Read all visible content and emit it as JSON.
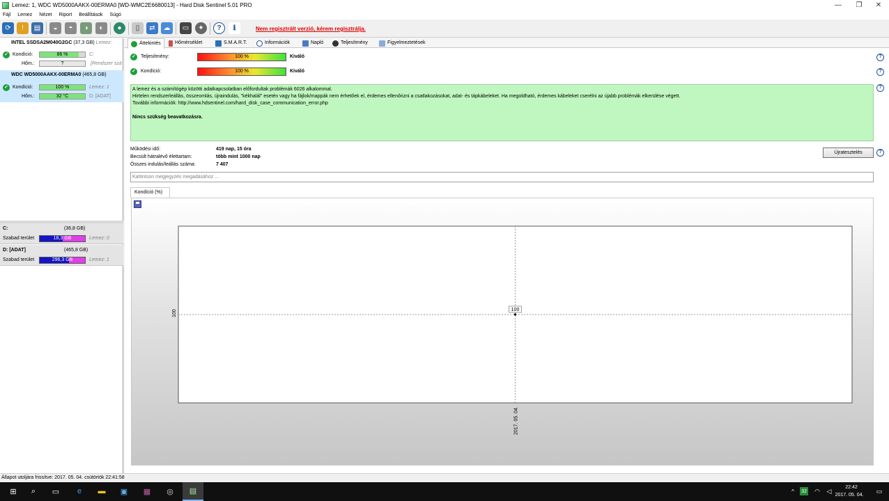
{
  "window": {
    "title": "Lemez: 1, WDC WD5000AAKX-00ERMA0 [WD-WMC2E6680013]  -  Hard Disk Sentinel 5.01 PRO",
    "controls": {
      "minimize": "—",
      "restore": "❐",
      "close": "✕"
    }
  },
  "menu": [
    "Fájl",
    "Lemez",
    "Nézet",
    "Riport",
    "Beállítások",
    "Súgó"
  ],
  "toolbar": {
    "registration_link": "Nem regisztrált verzió, kérem regisztrálja."
  },
  "disks": [
    {
      "name": "INTEL SSDSA2M040G2GC",
      "size": "(37,3 GB)",
      "disk_label": "Lemez:",
      "condition_label": "Kondíció:",
      "condition_value": "86 %",
      "condition_fraction": 0.86,
      "condition_extra": "C:",
      "temp_label": "Hőm.:",
      "temp_value": "?",
      "temp_extra": "[Rendszer szá"
    },
    {
      "name": "WDC WD5000AAKX-00ERMA0",
      "size": "(465,8 GB)",
      "condition_label": "Kondíció:",
      "condition_value": "100 %",
      "condition_fraction": 1.0,
      "condition_extra": "Lemez: 1",
      "temp_label": "Hőm.:",
      "temp_value": "32 °C",
      "temp_extra": "D: [ADAT]"
    }
  ],
  "volumes": [
    {
      "name": "C:",
      "size": "(36,8 GB)",
      "free_label": "Szabad terület",
      "free_value": "18,3 GB",
      "free_fraction": 0.5,
      "disk": "Lemez: 0"
    },
    {
      "name": "D: [ADAT]",
      "size": "(465,8 GB)",
      "free_label": "Szabad terület",
      "free_value": "296,3 GB",
      "free_fraction": 0.64,
      "disk": "Lemez: 1"
    }
  ],
  "tabs": [
    "Áttekintés",
    "Hőmérséklet",
    "S.M.A.R.T.",
    "Információk",
    "Napló",
    "Teljesítmény",
    "Figyelmeztetések"
  ],
  "overview": {
    "performance": {
      "label": "Teljesítmény:",
      "value": "100 %",
      "fraction": 1.0,
      "verdict": "Kiváló"
    },
    "condition": {
      "label": "Kondíció:",
      "value": "100 %",
      "fraction": 1.0,
      "verdict": "Kiváló"
    },
    "message_lines": [
      "A lemez és a számítógép közötti adatkapcsolatban előfordultak problémák 6026 alkalommal.",
      "Hirtelen rendszerleállás, összeomlás, újraindulás, \"kékhalál\" esetén vagy ha fájlok/mappák nem érhetőek el, érdemes ellenőrizni a csatlakozásokat, adat- és tápkábeleket. Ha megoldható, érdemes kábeleket cserélni az újabb problémák elkerülése végett.",
      "További információk: http://www.hdsentinel.com/hard_disk_case_communication_error.php"
    ],
    "message_action": "Nincs szükség beavatkozásra.",
    "stats": [
      {
        "label": "Működési idő:",
        "value": "419 nap, 15 óra"
      },
      {
        "label": "Becsült hátralévő élettartam:",
        "value": "több mint 1000 nap"
      },
      {
        "label": "Összes indulás/leállás száma:",
        "value": "7 407"
      }
    ],
    "reset_button": "Újratesztelés",
    "note_placeholder": "Kattintson megjegyzés megadásához ..."
  },
  "chart_tab": "Kondíció  (%)",
  "chart_data": {
    "type": "line",
    "x": [
      "2017. 05. 04."
    ],
    "series": [
      {
        "values": [
          100
        ]
      }
    ],
    "y_tick_labels": [
      "100"
    ],
    "data_labels": [
      "100"
    ],
    "grid": true
  },
  "statusbar": "Állapot utoljára frissítve: 2017. 05. 04. csütörtök 22:41:58",
  "taskbar": {
    "time": "22:42",
    "date": "2017. 05. 04.",
    "tray_badge": "32"
  },
  "colors": {
    "ok_green": "#1f9e3a",
    "message_bg": "#c0f7c0",
    "registration_red": "#e00000",
    "selected_disk": "#cce8ff",
    "volume_used": "#1414c8",
    "volume_free": "#e040e8"
  }
}
